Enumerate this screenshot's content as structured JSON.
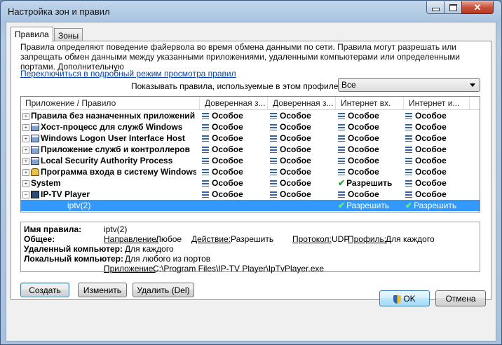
{
  "window": {
    "title": "Настройка зон и правил"
  },
  "tabs": [
    {
      "label": "Правила"
    },
    {
      "label": "Зоны"
    }
  ],
  "description": "Правила определяют поведение файервола во время обмена данными по сети. Правила могут разрешать или запрещать обмен данными между указанными приложениями, удаленными компьютерами или определенными портами. Дополнительную",
  "detail_link": "Переключиться в подробный режим просмотра правил",
  "profile": {
    "label": "Показывать правила, используемые в этом профиле:",
    "value": "Все"
  },
  "grid": {
    "columns": [
      "Приложение / Правило",
      "Доверенная з...",
      "Доверенная з...",
      "Интернет вх.",
      "Интернет и..."
    ],
    "rows": [
      {
        "name": "Правила без назначенных приложений",
        "expander": "+",
        "icon": "none",
        "v": [
          "Особое",
          "Особое",
          "Особое",
          "Особое"
        ],
        "check": [
          false,
          false,
          false,
          false
        ]
      },
      {
        "name": "Хост-процесс для служб Windows",
        "expander": "+",
        "icon": "app",
        "v": [
          "Особое",
          "Особое",
          "Особое",
          "Особое"
        ],
        "check": [
          false,
          false,
          false,
          false
        ]
      },
      {
        "name": "Windows Logon User Interface Host",
        "expander": "+",
        "icon": "app",
        "v": [
          "Особое",
          "Особое",
          "Особое",
          "Особое"
        ],
        "check": [
          false,
          false,
          false,
          false
        ]
      },
      {
        "name": "Приложение служб и контроллеров",
        "expander": "+",
        "icon": "app",
        "v": [
          "Особое",
          "Особое",
          "Особое",
          "Особое"
        ],
        "check": [
          false,
          false,
          false,
          false
        ]
      },
      {
        "name": "Local Security Authority Process",
        "expander": "+",
        "icon": "app",
        "v": [
          "Особое",
          "Особое",
          "Особое",
          "Особое"
        ],
        "check": [
          false,
          false,
          false,
          false
        ]
      },
      {
        "name": "Программа входа в систему Windows",
        "expander": "+",
        "icon": "lock",
        "v": [
          "Особое",
          "Особое",
          "Особое",
          "Особое"
        ],
        "check": [
          false,
          false,
          false,
          false
        ]
      },
      {
        "name": "System",
        "expander": "+",
        "icon": "none",
        "v": [
          "Особое",
          "Особое",
          "Разрешить",
          "Особое"
        ],
        "check": [
          false,
          false,
          true,
          false
        ]
      },
      {
        "name": "IP-TV Player",
        "expander": "−",
        "icon": "tv",
        "v": [
          "Особое",
          "Особое",
          "Особое",
          "Особое"
        ],
        "check": [
          false,
          false,
          false,
          false
        ]
      },
      {
        "name": "iptv(2)",
        "expander": "",
        "icon": "child",
        "v": [
          "",
          "",
          "Разрешить",
          "Разрешить"
        ],
        "check": [
          false,
          false,
          true,
          true
        ],
        "selected": true
      }
    ]
  },
  "props": {
    "rule_name_label": "Имя правила:",
    "rule_name": "iptv(2)",
    "general_label": "Общее:",
    "direction_label": "Направление:",
    "direction": "Любое",
    "action_label": "Действие:",
    "action": "Разрешить",
    "protocol_label": "Протокол:",
    "protocol": "UDP",
    "profile_label": "Профиль:",
    "profile": "Для каждого",
    "remote_label": "Удаленный компьютер:",
    "remote": "Для каждого",
    "local_label": "Локальный компьютер:",
    "local": "Для любого из портов",
    "app_label": "Приложение:",
    "app": "C:\\Program Files\\IP-TV Player\\IpTvPlayer.exe"
  },
  "buttons": {
    "create": "Создать",
    "edit": "Изменить",
    "delete": "Удалить (Del)",
    "ok": "OK",
    "cancel": "Отмена"
  }
}
